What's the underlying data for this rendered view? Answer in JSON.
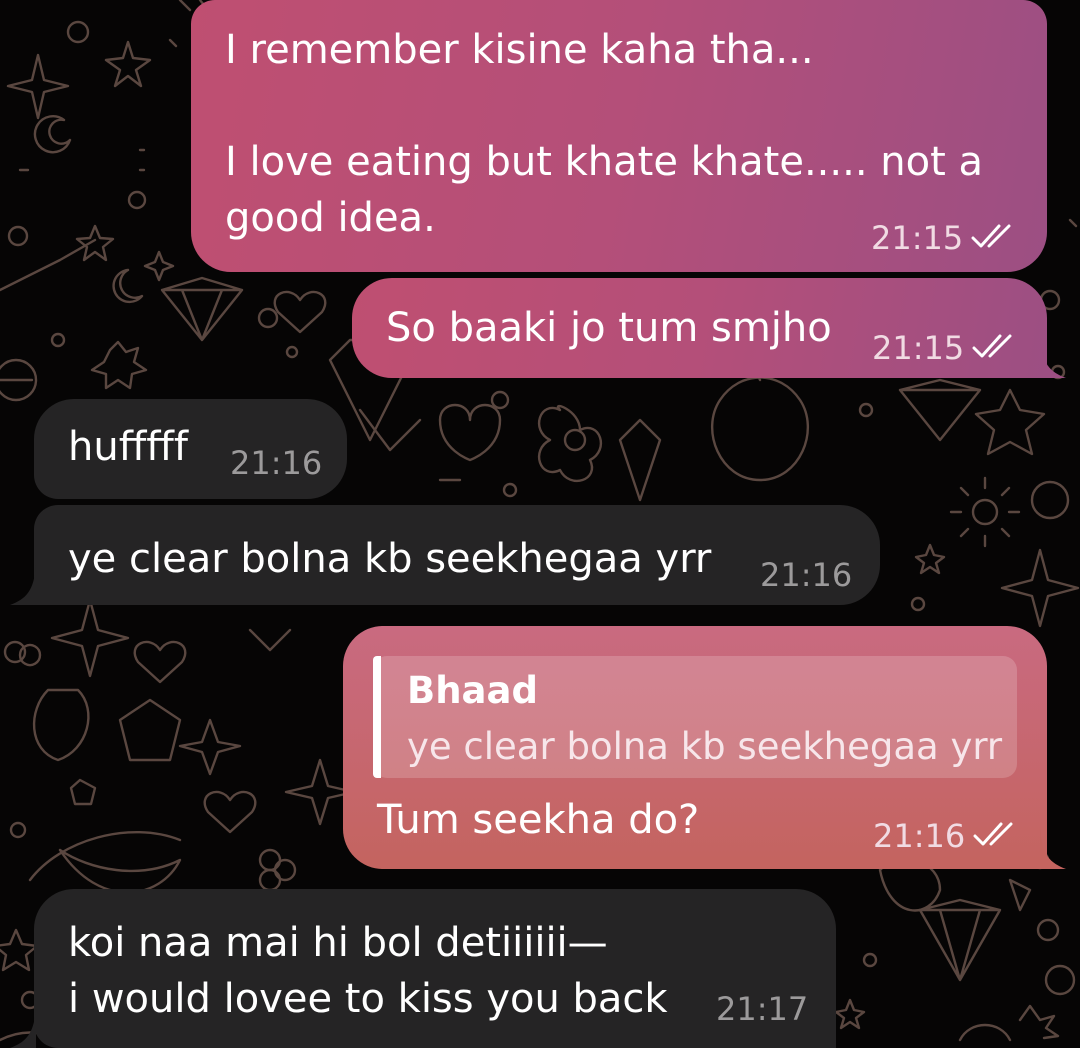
{
  "chat": {
    "messages": [
      {
        "direction": "outgoing",
        "text": "I remember kisine kaha tha...\n\nI love eating but khate khate..... not a\ngood idea.",
        "time": "21:15",
        "status": "read"
      },
      {
        "direction": "outgoing",
        "text": "So baaki jo tum smjho",
        "time": "21:15",
        "status": "read"
      },
      {
        "direction": "incoming",
        "text": "hufffff",
        "time": "21:16"
      },
      {
        "direction": "incoming",
        "text": "ye clear bolna kb seekhegaa yrr",
        "time": "21:16"
      },
      {
        "direction": "outgoing",
        "reply_to": {
          "sender": "Bhaad",
          "text": "ye clear bolna kb seekhegaa yrr"
        },
        "text": "Tum seekha do?",
        "time": "21:16",
        "status": "read"
      },
      {
        "direction": "incoming",
        "text": "koi naa mai hi bol detiiiiii—\ni would lovee to kiss you back",
        "time": "21:17"
      }
    ]
  },
  "theme": {
    "background": "#060505",
    "outgoing_bubble": "#b44f79",
    "incoming_bubble": "#252425",
    "doodle_color": "#5a4740"
  },
  "icons": [
    "double-check-icon",
    "doodle-pattern"
  ]
}
